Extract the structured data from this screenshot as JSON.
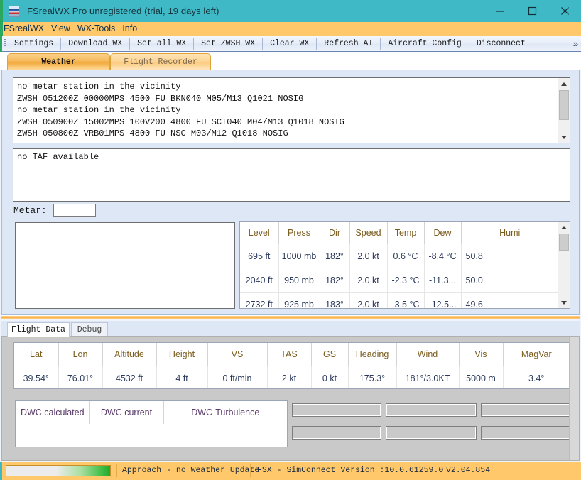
{
  "window": {
    "title": "FSrealWX Pro unregistered (trial, 19 days left)",
    "minimize_label": "minimize",
    "maximize_label": "maximize",
    "close_label": "close",
    "accent_color": "#3fb9c6"
  },
  "menubar": {
    "items": [
      {
        "label": "FSrealWX"
      },
      {
        "label": "View"
      },
      {
        "label": "WX-Tools"
      },
      {
        "label": "Info"
      }
    ]
  },
  "toolbar": {
    "buttons": [
      {
        "label": "Settings"
      },
      {
        "label": "Download WX"
      },
      {
        "label": "Set all WX"
      },
      {
        "label": "Set ZWSH WX"
      },
      {
        "label": "Clear WX"
      },
      {
        "label": "Refresh AI"
      },
      {
        "label": "Aircraft Config"
      },
      {
        "label": "Disconnect"
      }
    ],
    "overflow": "»"
  },
  "tabs": {
    "top": [
      {
        "label": "Weather",
        "active": true
      },
      {
        "label": "Flight Recorder",
        "active": false
      }
    ],
    "bottom": [
      {
        "label": "Flight Data",
        "active": true
      },
      {
        "label": "Debug",
        "active": false
      }
    ]
  },
  "weather": {
    "metar_lines": [
      "no metar station in the vicinity",
      "ZWSH 051200Z 00000MPS 4500 FU BKN040 M05/M13 Q1021 NOSIG",
      "no metar station in the vicinity",
      "ZWSH 050900Z 15002MPS 100V200 4800 FU SCT040 M04/M13 Q1018 NOSIG",
      "ZWSH 050800Z VRB01MPS 4800 FU NSC M03/M12 Q1018 NOSIG"
    ],
    "metar_text": "no metar station in the vicinity\nZWSH 051200Z 00000MPS 4500 FU BKN040 M05/M13 Q1021 NOSIG\nno metar station in the vicinity\nZWSH 050900Z 15002MPS 100V200 4800 FU SCT040 M04/M13 Q1018 NOSIG\nZWSH 050800Z VRB01MPS 4800 FU NSC M03/M12 Q1018 NOSIG",
    "taf_text": "no TAF available",
    "metar_field": {
      "label": "Metar:",
      "value": "",
      "placeholder": ""
    }
  },
  "level_table": {
    "columns": [
      "Level",
      "Press",
      "Dir",
      "Speed",
      "Temp",
      "Dew",
      "Humi"
    ],
    "rows": [
      [
        "695 ft",
        "1000 mb",
        "182°",
        "2.0 kt",
        "0.6 °C",
        "-8.4 °C",
        "50.8"
      ],
      [
        "2040 ft",
        "950 mb",
        "182°",
        "2.0 kt",
        "-2.3 °C",
        "-11.3...",
        "50.0"
      ],
      [
        "2732 ft",
        "925 mb",
        "183°",
        "2.0 kt",
        "-3.5 °C",
        "-12.5...",
        "49.6"
      ]
    ]
  },
  "flight_data": {
    "columns": [
      "Lat",
      "Lon",
      "Altitude",
      "Height",
      "VS",
      "TAS",
      "GS",
      "Heading",
      "Wind",
      "Vis",
      "MagVar"
    ],
    "rows": [
      [
        "39.54°",
        "76.01°",
        "4532 ft",
        "4 ft",
        "0 ft/min",
        "2 kt",
        "0 kt",
        "175.3°",
        "181°/3.0KT",
        "5000 m",
        "3.4°"
      ]
    ]
  },
  "dwc": {
    "columns": [
      "DWC calculated",
      "DWC current",
      "DWC-Turbulence"
    ],
    "fields": [
      "",
      "",
      "",
      "",
      "",
      ""
    ]
  },
  "statusbar": {
    "progress_percent": 100,
    "status": "Approach - no Weather Update",
    "simconnect": "FSX - SimConnect Version :10.0.61259.0",
    "version": "v2.04.854"
  }
}
